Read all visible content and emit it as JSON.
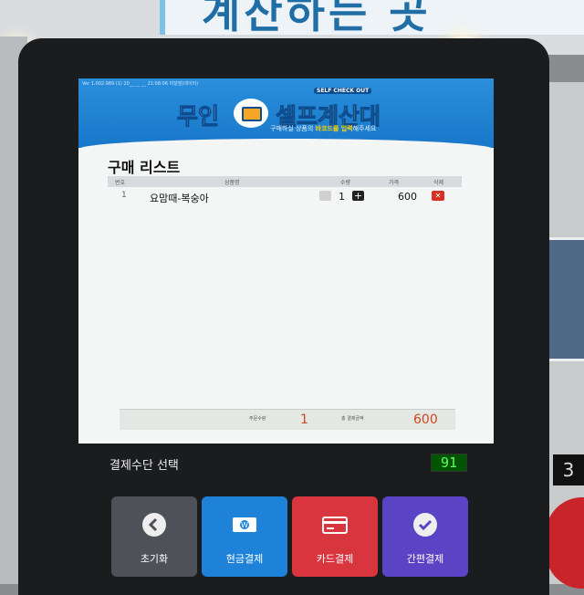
{
  "wall": {
    "sign_text": "계산하는 곳"
  },
  "kiosk": {
    "version_text": "Ver 1.002.989 (1) 20__ __ __ 21:08:06 미달발(데이터)",
    "header": {
      "logo_muin": "무인",
      "logo_self": "셀프계산대",
      "logo_eng": "SELF CHECK OUT",
      "guide_prefix": "구매하실 상품의 ",
      "guide_highlight": "바코드를 입력",
      "guide_suffix": "해주세요"
    },
    "list": {
      "title": "구매 리스트",
      "columns": {
        "no": "번호",
        "name": "상품명",
        "qty": "수량",
        "price": "가격",
        "delete": "삭제"
      },
      "rows": [
        {
          "no": "1",
          "name": "요맘때-복숭아",
          "qty": "1",
          "price": "600",
          "delete_icon": "x-icon"
        }
      ]
    },
    "summary": {
      "qty_label": "주문수량",
      "qty_value": "1",
      "total_label": "총 결제금액",
      "total_value": "600"
    },
    "payment": {
      "section_label": "결제수단 선택",
      "timer": "91",
      "buttons": {
        "reset": "초기화",
        "cash": "현금결제",
        "card": "카드결제",
        "easy": "간편결제"
      }
    }
  },
  "colors": {
    "header_blue": "#1e83d8",
    "accent_yellow": "#ffd400",
    "reset": "#4e5258",
    "cash": "#1e83d8",
    "card": "#d8353f",
    "easy": "#5b43c5",
    "price_red": "#d1461f"
  }
}
